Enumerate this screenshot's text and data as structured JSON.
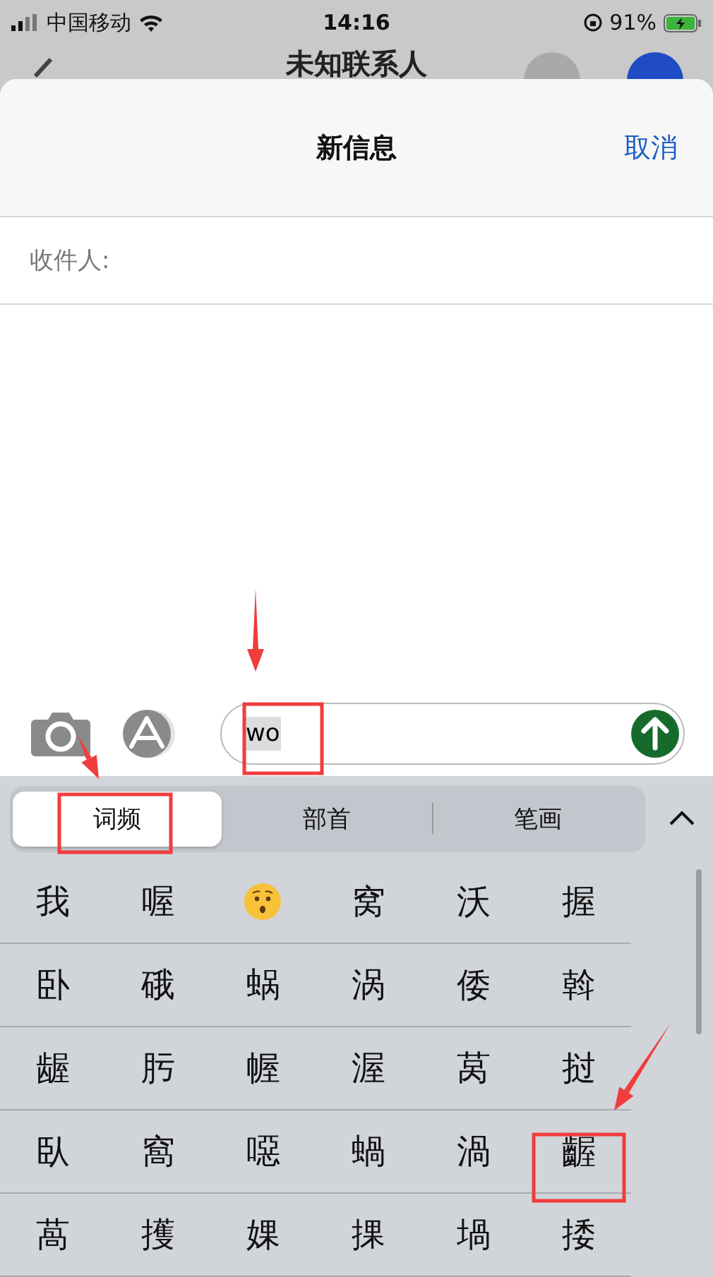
{
  "status_bar": {
    "carrier": "中国移动",
    "time": "14:16",
    "battery": "91%"
  },
  "background_nav": {
    "title": "未知联系人"
  },
  "sheet": {
    "title": "新信息",
    "cancel": "取消",
    "recipient_label": "收件人:"
  },
  "input": {
    "value": "wo"
  },
  "keyboard": {
    "tabs": [
      {
        "label": "词频",
        "selected": true
      },
      {
        "label": "部首",
        "selected": false
      },
      {
        "label": "笔画",
        "selected": false
      }
    ],
    "candidates": [
      {
        "kind": "char",
        "text": "我"
      },
      {
        "kind": "char",
        "text": "喔"
      },
      {
        "kind": "emoji"
      },
      {
        "kind": "char",
        "text": "窝"
      },
      {
        "kind": "char",
        "text": "沃"
      },
      {
        "kind": "char",
        "text": "握"
      },
      {
        "kind": "char",
        "text": "卧"
      },
      {
        "kind": "char",
        "text": "硪"
      },
      {
        "kind": "char",
        "text": "蜗"
      },
      {
        "kind": "char",
        "text": "涡"
      },
      {
        "kind": "char",
        "text": "倭"
      },
      {
        "kind": "char",
        "text": "斡"
      },
      {
        "kind": "char",
        "text": "龌"
      },
      {
        "kind": "char",
        "text": "肟"
      },
      {
        "kind": "char",
        "text": "幄"
      },
      {
        "kind": "char",
        "text": "渥"
      },
      {
        "kind": "char",
        "text": "莴"
      },
      {
        "kind": "char",
        "text": "挝"
      },
      {
        "kind": "char",
        "text": "臥"
      },
      {
        "kind": "char",
        "text": "窩"
      },
      {
        "kind": "char",
        "text": "噁"
      },
      {
        "kind": "char",
        "text": "蝸"
      },
      {
        "kind": "char",
        "text": "渦"
      },
      {
        "kind": "char",
        "text": "齷"
      },
      {
        "kind": "char",
        "text": "萵"
      },
      {
        "kind": "char",
        "text": "擭"
      },
      {
        "kind": "char",
        "text": "婐"
      },
      {
        "kind": "char",
        "text": "捰"
      },
      {
        "kind": "char",
        "text": "堝"
      },
      {
        "kind": "char",
        "text": "捼"
      }
    ]
  }
}
